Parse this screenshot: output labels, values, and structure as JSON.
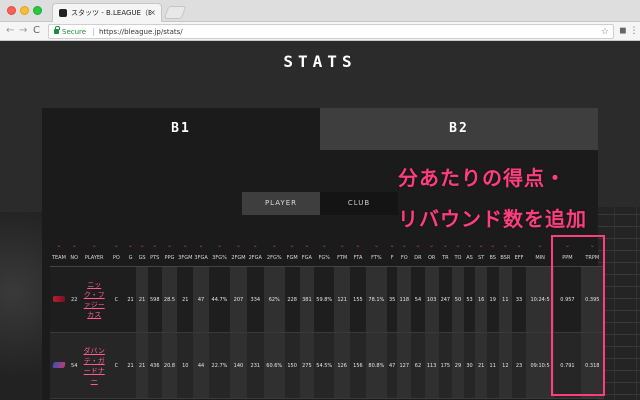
{
  "browser": {
    "tab_title": "スタッツ - B.LEAGUE（Bリーグ）",
    "tab_close": "×",
    "secure_label": "Secure",
    "url": "https://bleague.jp/stats/",
    "nav": {
      "back": "←",
      "forward": "→",
      "reload": "C"
    },
    "star": "☆"
  },
  "page": {
    "title": "STATS",
    "league_tabs": [
      {
        "label": "B1"
      },
      {
        "label": "B2"
      }
    ],
    "segment": {
      "player": "PLAYER",
      "club": "CLUB"
    }
  },
  "annotation": {
    "line1": "分あたりの得点・",
    "line2": "リバウンド数を追加",
    "color": "#ff3d7f"
  },
  "table": {
    "columns": [
      "TEAM",
      "NO",
      "PLAYER",
      "PO",
      "G",
      "GS",
      "PTS",
      "PPG",
      "3FGM",
      "3FGA",
      "3FG%",
      "2FGM",
      "2FGA",
      "2FG%",
      "FGM",
      "FGA",
      "FG%",
      "FTM",
      "FTA",
      "FT%",
      "F",
      "FO",
      "DR",
      "OR",
      "TR",
      "TO",
      "AS",
      "ST",
      "BS",
      "BSR",
      "EFF",
      "MIN",
      "PPM",
      "TRPM"
    ],
    "sort_glyph": "⌄",
    "rows": [
      {
        "no": "22",
        "player": "ニック・ファジーカス",
        "po": "C",
        "g": "21",
        "gs": "21",
        "pts": "598",
        "ppg": "28.5",
        "fgm3": "21",
        "fga3": "47",
        "fgp3": "44.7%",
        "fgm2": "207",
        "fga2": "334",
        "fgp2": "62%",
        "fgm": "228",
        "fga": "381",
        "fgp": "59.8%",
        "ftm": "121",
        "fta": "155",
        "ftp": "78.1%",
        "f": "35",
        "fo": "118",
        "dr": "54",
        "or": "103",
        "tr": "247",
        "to": "50",
        "as": "53",
        "st": "16",
        "bs": "19",
        "bsr": "11",
        "eff": "33",
        "min": "10:24:5",
        "ppm": "0.957",
        "trpm": "0.395"
      },
      {
        "no": "54",
        "player": "ダバンテ・ガードナー",
        "po": "C",
        "g": "21",
        "gs": "21",
        "pts": "436",
        "ppg": "20.8",
        "fgm3": "10",
        "fga3": "44",
        "fgp3": "22.7%",
        "fgm2": "140",
        "fga2": "231",
        "fgp2": "60.6%",
        "fgm": "150",
        "fga": "275",
        "fgp": "54.5%",
        "ftm": "126",
        "fta": "156",
        "ftp": "80.8%",
        "f": "47",
        "fo": "127",
        "dr": "62",
        "or": "113",
        "tr": "175",
        "to": "29",
        "as": "30",
        "st": "21",
        "bs": "11",
        "bsr": "12",
        "eff": "23",
        "min": "09:10:5",
        "ppm": "0.791",
        "trpm": "0.318"
      }
    ]
  }
}
